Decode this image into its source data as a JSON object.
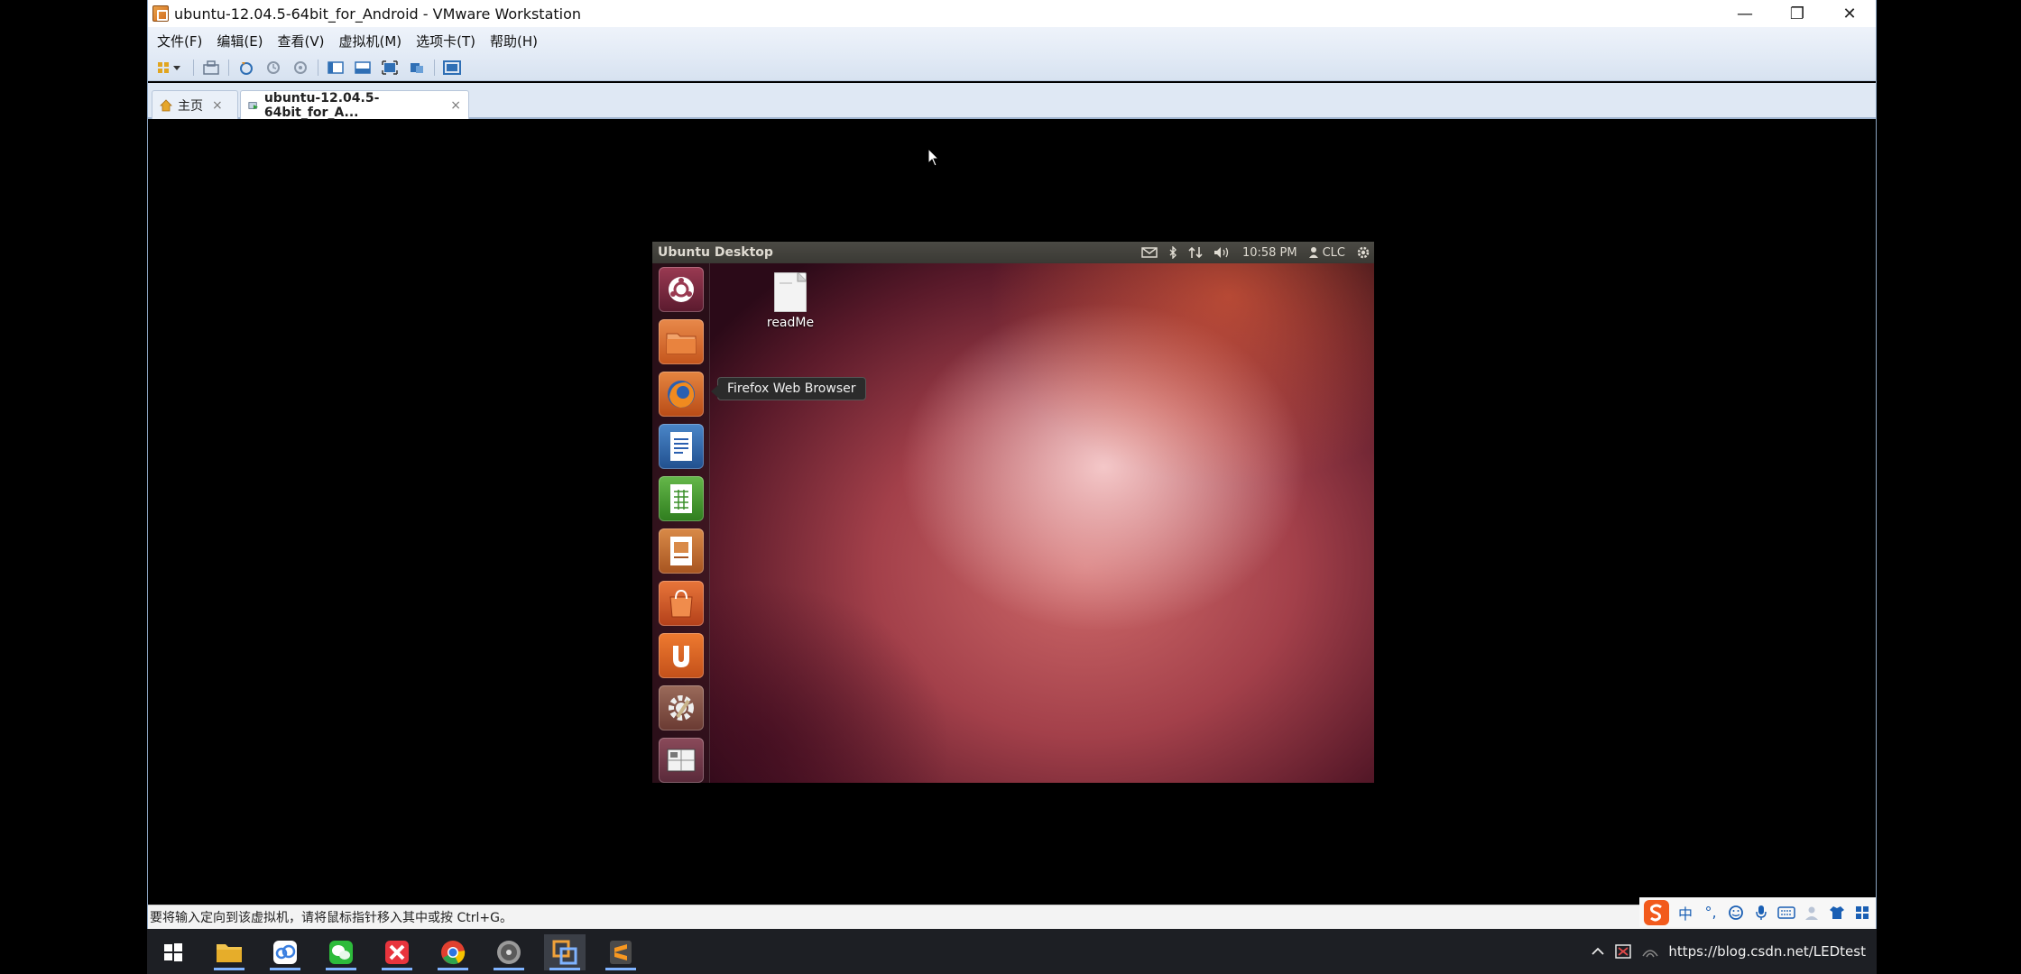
{
  "window": {
    "title": "ubuntu-12.04.5-64bit_for_Android - VMware Workstation",
    "minimize": "—",
    "restore": "❐",
    "close": "✕"
  },
  "menu": {
    "items": [
      "文件(F)",
      "编辑(E)",
      "查看(V)",
      "虚拟机(M)",
      "选项卡(T)",
      "帮助(H)"
    ]
  },
  "tabs": [
    {
      "label": "主页",
      "close": "×"
    },
    {
      "label": "ubuntu-12.04.5-64bit_for_A...",
      "close": "×"
    }
  ],
  "guest": {
    "panel_title": "Ubuntu Desktop",
    "time": "10:58 PM",
    "user": "CLC",
    "tooltip": "Firefox Web Browser",
    "desktop_file": "readMe",
    "launcher_icons": [
      "dash-home",
      "files",
      "firefox",
      "writer",
      "calc",
      "impress",
      "software-center",
      "ubuntu-one",
      "system-settings",
      "workspace-switcher"
    ]
  },
  "statusbar": {
    "message": "要将输入定向到该虚拟机，请将鼠标指针移入其中或按 Ctrl+G。"
  },
  "ime": {
    "lang": "中",
    "punct": "°,"
  },
  "taskbar": {
    "watermark": "https://blog.csdn.net/LEDtest"
  },
  "colors": {
    "ubuntu_orange": "#dd4814",
    "vm_menu_bg": "#e3ebf6",
    "taskbar_bg": "#1d1f24"
  }
}
